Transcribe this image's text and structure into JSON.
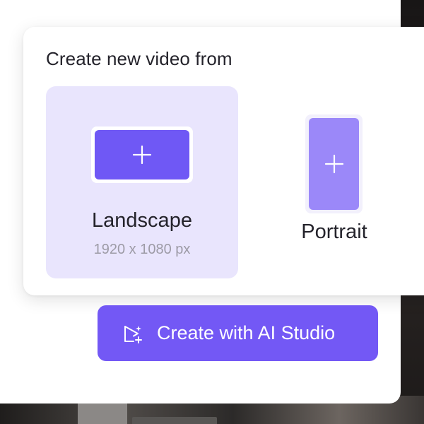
{
  "dialog": {
    "title": "Create new video from",
    "options": [
      {
        "label": "Landscape",
        "sublabel": "1920 x 1080 px",
        "icon": "plus-icon"
      },
      {
        "label": "Portrait",
        "icon": "plus-icon"
      }
    ]
  },
  "ai_button": {
    "label": "Create with AI Studio",
    "icon": "ai-studio-icon"
  },
  "colors": {
    "accent": "#7358f5",
    "landscape_bg": "#e9e5fd",
    "portrait_fill": "#9b88f9",
    "text_primary": "#24232b",
    "text_secondary": "#9d9ba6"
  }
}
